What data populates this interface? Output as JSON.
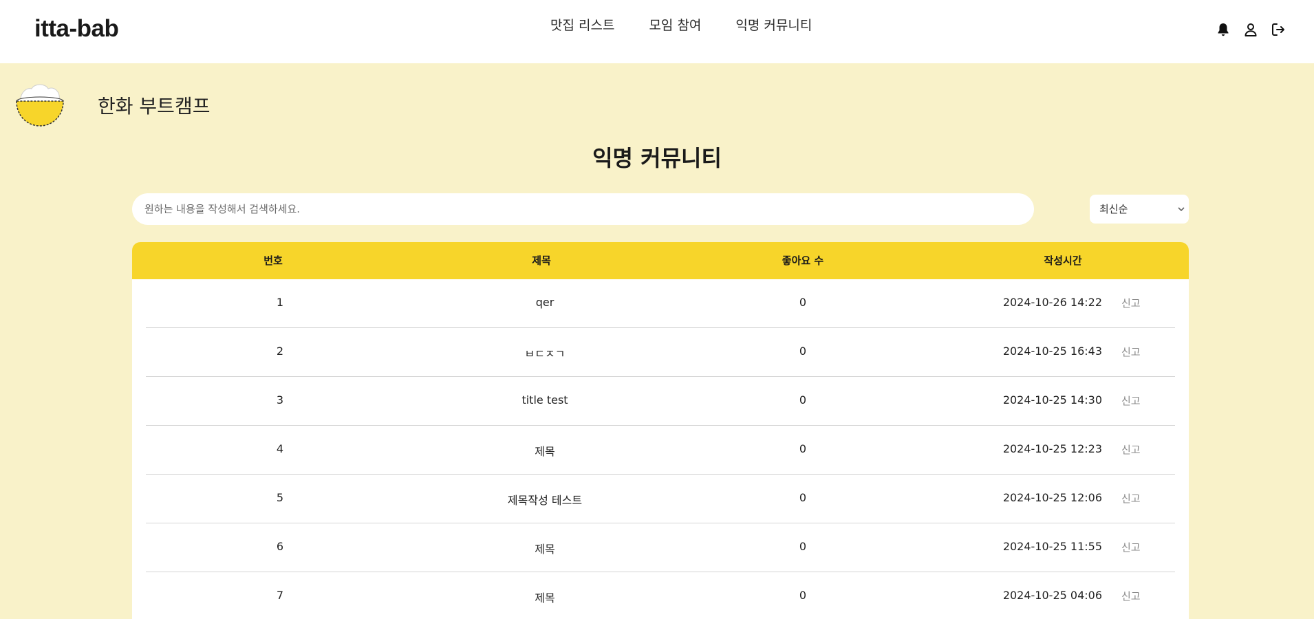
{
  "header": {
    "logo": "itta-bab",
    "nav": [
      "맛집 리스트",
      "모임 참여",
      "익명 커뮤니티"
    ],
    "icons": [
      "bell-icon",
      "user-icon",
      "logout-icon"
    ]
  },
  "group": {
    "name": "한화 부트캠프",
    "logo_icon": "rice-bowl-icon"
  },
  "page": {
    "title": "익명 커뮤니티"
  },
  "search": {
    "placeholder": "원하는 내용을 작성해서 검색하세요."
  },
  "sort": {
    "selected": "최신순"
  },
  "table": {
    "headers": [
      "번호",
      "제목",
      "좋아요 수",
      "작성시간"
    ],
    "report_label": "신고",
    "rows": [
      {
        "no": "1",
        "title": "qer",
        "likes": "0",
        "time": "2024-10-26 14:22"
      },
      {
        "no": "2",
        "title": "ㅂㄷㅈㄱ",
        "likes": "0",
        "time": "2024-10-25 16:43"
      },
      {
        "no": "3",
        "title": "title test",
        "likes": "0",
        "time": "2024-10-25 14:30"
      },
      {
        "no": "4",
        "title": "제목",
        "likes": "0",
        "time": "2024-10-25 12:23"
      },
      {
        "no": "5",
        "title": "제목작성 테스트",
        "likes": "0",
        "time": "2024-10-25 12:06"
      },
      {
        "no": "6",
        "title": "제목",
        "likes": "0",
        "time": "2024-10-25 11:55"
      },
      {
        "no": "7",
        "title": "제목",
        "likes": "0",
        "time": "2024-10-25 04:06"
      }
    ]
  },
  "colors": {
    "background": "#f9f2c9",
    "accent": "#f7d52a",
    "surface": "#ffffff"
  }
}
